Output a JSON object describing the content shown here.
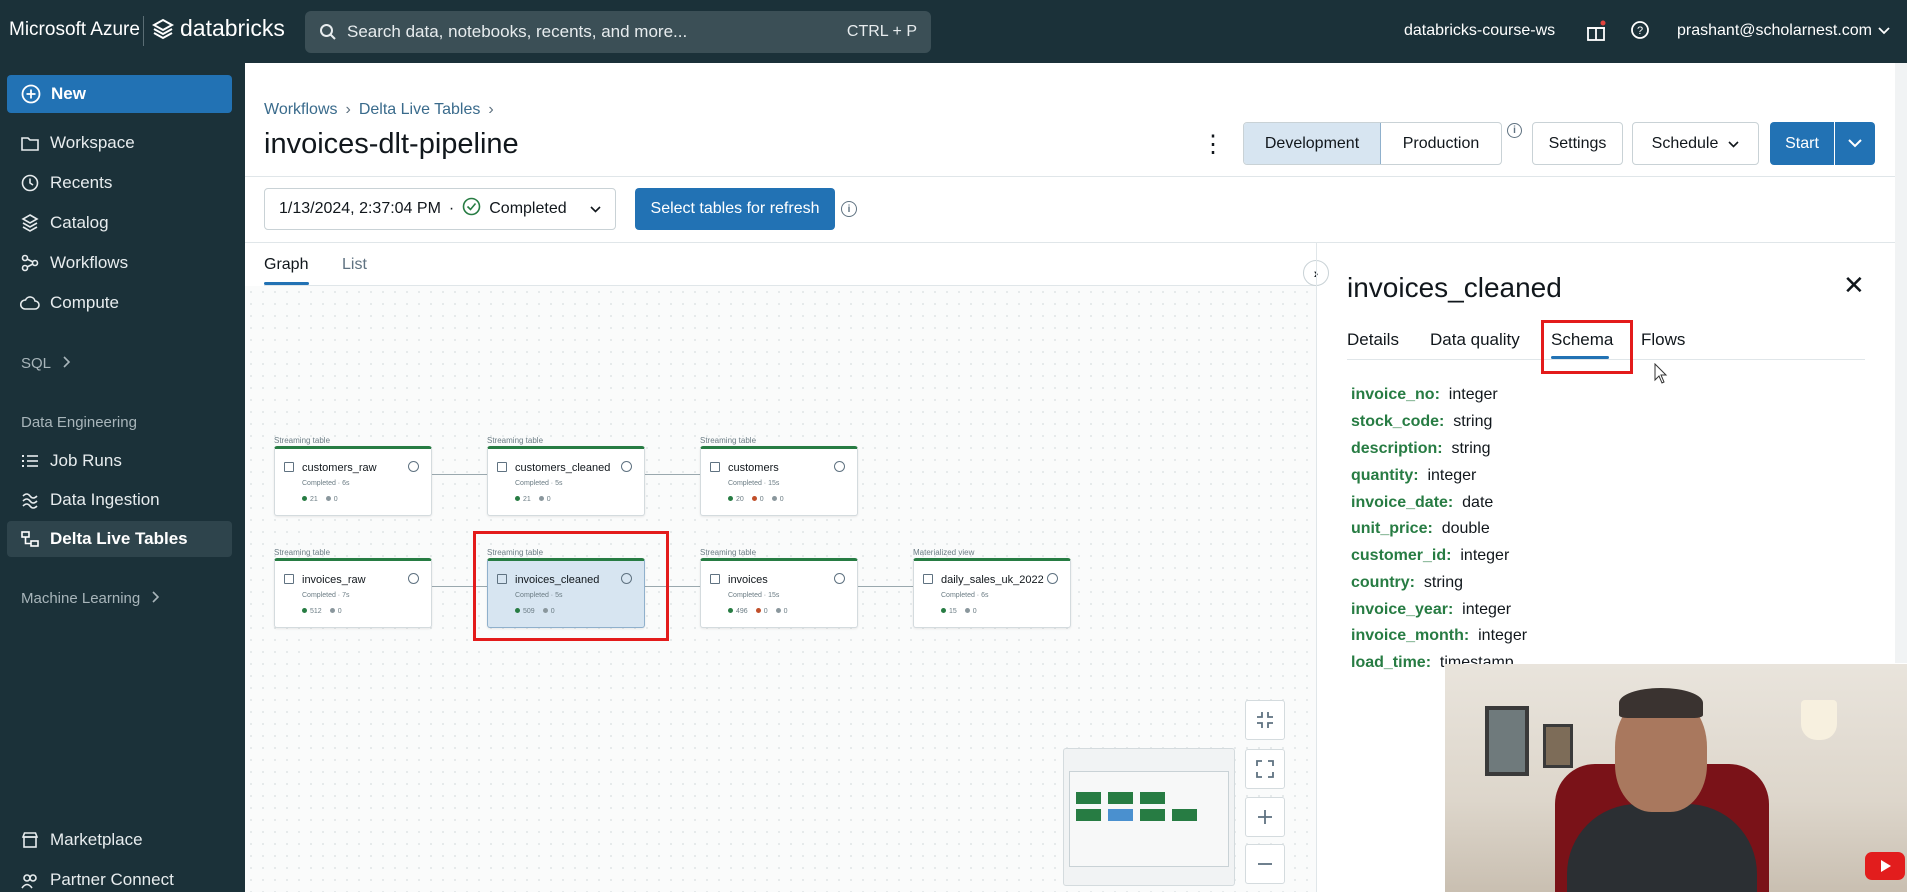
{
  "topbar": {
    "brand_ms": "Microsoft Azure",
    "brand_db": "databricks",
    "search_placeholder": "Search data, notebooks, recents, and more...",
    "search_shortcut": "CTRL + P",
    "workspace": "databricks-course-ws",
    "user": "prashant@scholarnest.com"
  },
  "sidebar": {
    "new_label": "New",
    "items": [
      {
        "label": "Workspace",
        "icon": "folder-icon"
      },
      {
        "label": "Recents",
        "icon": "clock-icon"
      },
      {
        "label": "Catalog",
        "icon": "catalog-icon"
      },
      {
        "label": "Workflows",
        "icon": "workflows-icon"
      },
      {
        "label": "Compute",
        "icon": "cloud-icon"
      }
    ],
    "sql_label": "SQL",
    "data_engineering_label": "Data Engineering",
    "de_items": [
      {
        "label": "Job Runs",
        "icon": "list-icon"
      },
      {
        "label": "Data Ingestion",
        "icon": "ingest-icon"
      },
      {
        "label": "Delta Live Tables",
        "icon": "pipeline-icon"
      }
    ],
    "ml_label": "Machine Learning",
    "bottom_items": [
      {
        "label": "Marketplace",
        "icon": "store-icon"
      },
      {
        "label": "Partner Connect",
        "icon": "partner-icon"
      }
    ]
  },
  "header": {
    "breadcrumb": [
      "Workflows",
      "Delta Live Tables"
    ],
    "title": "invoices-dlt-pipeline",
    "mode_development": "Development",
    "mode_production": "Production",
    "settings": "Settings",
    "schedule": "Schedule",
    "start": "Start"
  },
  "run": {
    "timestamp": "1/13/2024, 2:37:04 PM",
    "separator": "·",
    "status": "Completed",
    "refresh_button": "Select tables for refresh"
  },
  "view_tabs": {
    "graph": "Graph",
    "list": "List"
  },
  "graph": {
    "nodes": [
      {
        "type": "Streaming table",
        "name": "customers_raw",
        "status": "Completed · 6s",
        "m1": "21",
        "m2": "0",
        "m3": ""
      },
      {
        "type": "Streaming table",
        "name": "customers_cleaned",
        "status": "Completed · 5s",
        "m1": "21",
        "m2": "0",
        "m3": ""
      },
      {
        "type": "Streaming table",
        "name": "customers",
        "status": "Completed · 15s",
        "m1": "20",
        "m2": "0",
        "m3": "0"
      },
      {
        "type": "Streaming table",
        "name": "invoices_raw",
        "status": "Completed · 7s",
        "m1": "512",
        "m2": "0",
        "m3": ""
      },
      {
        "type": "Streaming table",
        "name": "invoices_cleaned",
        "status": "Completed · 5s",
        "m1": "509",
        "m2": "0",
        "m3": ""
      },
      {
        "type": "Streaming table",
        "name": "invoices",
        "status": "Completed · 15s",
        "m1": "496",
        "m2": "0",
        "m3": "0"
      },
      {
        "type": "Materialized view",
        "name": "daily_sales_uk_2022",
        "status": "Completed · 6s",
        "m1": "15",
        "m2": "0",
        "m3": ""
      }
    ]
  },
  "panel": {
    "title": "invoices_cleaned",
    "tabs": [
      "Details",
      "Data quality",
      "Schema",
      "Flows"
    ],
    "schema": [
      {
        "name": "invoice_no:",
        "type": "integer"
      },
      {
        "name": "stock_code:",
        "type": "string"
      },
      {
        "name": "description:",
        "type": "string"
      },
      {
        "name": "quantity:",
        "type": "integer"
      },
      {
        "name": "invoice_date:",
        "type": "date"
      },
      {
        "name": "unit_price:",
        "type": "double"
      },
      {
        "name": "customer_id:",
        "type": "integer"
      },
      {
        "name": "country:",
        "type": "string"
      },
      {
        "name": "invoice_year:",
        "type": "integer"
      },
      {
        "name": "invoice_month:",
        "type": "integer"
      },
      {
        "name": "load_time:",
        "type": "timestamp"
      }
    ]
  },
  "colors": {
    "brand_dark": "#1b3139",
    "accent": "#2272b4",
    "success": "#277c43",
    "highlight": "#e31b1b"
  }
}
